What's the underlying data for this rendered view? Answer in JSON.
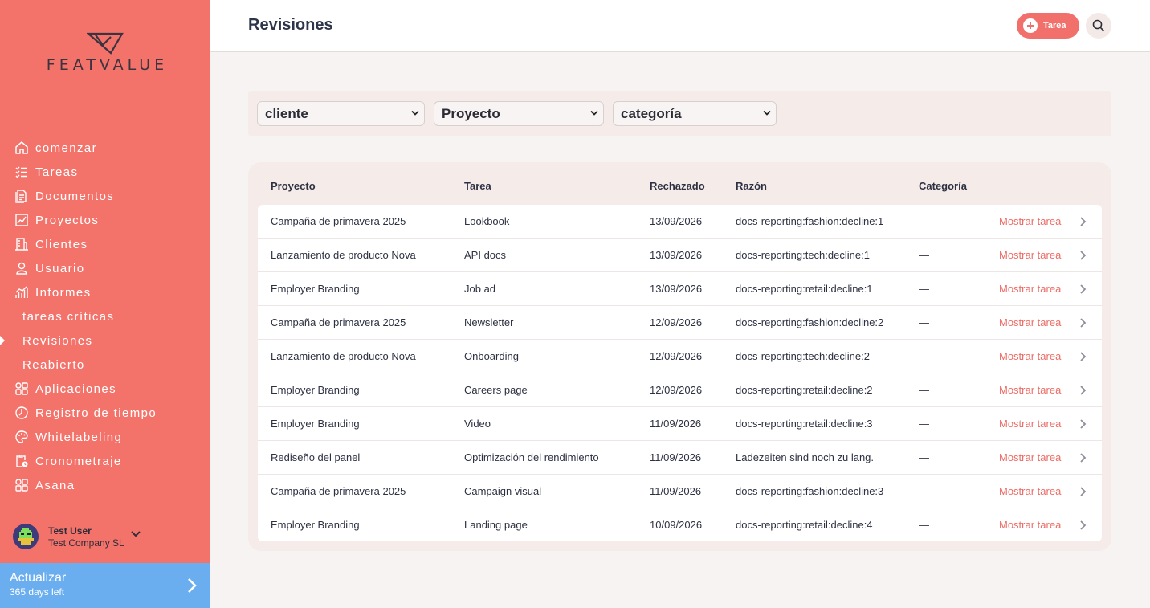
{
  "brand": {
    "name": "FEATVALUE"
  },
  "sidebar": {
    "items": [
      {
        "label": "comenzar",
        "icon": "home-icon"
      },
      {
        "label": "Tareas",
        "icon": "checklist-icon"
      },
      {
        "label": "Documentos",
        "icon": "documents-icon"
      },
      {
        "label": "Proyectos",
        "icon": "projects-icon"
      },
      {
        "label": "Clientes",
        "icon": "building-icon"
      },
      {
        "label": "Usuario",
        "icon": "user-icon"
      },
      {
        "label": "Informes",
        "icon": "bar-chart-icon"
      },
      {
        "label": "tareas críticas",
        "icon": ""
      },
      {
        "label": "Revisiones",
        "icon": ""
      },
      {
        "label": "Reabierto",
        "icon": ""
      },
      {
        "label": "Aplicaciones",
        "icon": "apps-icon"
      },
      {
        "label": "Registro de tiempo",
        "icon": "timer-icon"
      },
      {
        "label": "Whitelabeling",
        "icon": "palette-icon"
      },
      {
        "label": "Cronometraje",
        "icon": "clipboard-clock-icon"
      },
      {
        "label": "Asana",
        "icon": "apps-icon"
      }
    ],
    "active": "Revisiones"
  },
  "user": {
    "name": "Test User",
    "company": "Test Company SL"
  },
  "upgrade": {
    "title": "Actualizar",
    "subtitle": "365 days left",
    "color": "#6aaef0"
  },
  "header": {
    "title": "Revisiones",
    "task_button": "Tarea"
  },
  "filters": {
    "client": "cliente",
    "project": "Proyecto",
    "category": "categoría"
  },
  "table": {
    "headers": {
      "project": "Proyecto",
      "task": "Tarea",
      "rejected": "Rechazado",
      "reason": "Razón",
      "category": "Categoría"
    },
    "action_label": "Mostrar tarea",
    "rows": [
      {
        "project": "Campaña de primavera 2025",
        "task": "Lookbook",
        "rejected": "13/09/2026",
        "reason": "docs-reporting:fashion:decline:1",
        "category": "—"
      },
      {
        "project": "Lanzamiento de producto Nova",
        "task": "API docs",
        "rejected": "13/09/2026",
        "reason": "docs-reporting:tech:decline:1",
        "category": "—"
      },
      {
        "project": "Employer Branding",
        "task": "Job ad",
        "rejected": "13/09/2026",
        "reason": "docs-reporting:retail:decline:1",
        "category": "—"
      },
      {
        "project": "Campaña de primavera 2025",
        "task": "Newsletter",
        "rejected": "12/09/2026",
        "reason": "docs-reporting:fashion:decline:2",
        "category": "—"
      },
      {
        "project": "Lanzamiento de producto Nova",
        "task": "Onboarding",
        "rejected": "12/09/2026",
        "reason": "docs-reporting:tech:decline:2",
        "category": "—"
      },
      {
        "project": "Employer Branding",
        "task": "Careers page",
        "rejected": "12/09/2026",
        "reason": "docs-reporting:retail:decline:2",
        "category": "—"
      },
      {
        "project": "Employer Branding",
        "task": "Video",
        "rejected": "11/09/2026",
        "reason": "docs-reporting:retail:decline:3",
        "category": "—"
      },
      {
        "project": "Rediseño del panel",
        "task": "Optimización del rendimiento",
        "rejected": "11/09/2026",
        "reason": "Ladezeiten sind noch zu lang.",
        "category": "—"
      },
      {
        "project": "Campaña de primavera 2025",
        "task": "Campaign visual",
        "rejected": "11/09/2026",
        "reason": "docs-reporting:fashion:decline:3",
        "category": "—"
      },
      {
        "project": "Employer Branding",
        "task": "Landing page",
        "rejected": "10/09/2026",
        "reason": "docs-reporting:retail:decline:4",
        "category": "—"
      }
    ]
  },
  "colors": {
    "sidebar": "#f3726a",
    "accent": "#ec6d66",
    "background": "#f7f3f2"
  }
}
